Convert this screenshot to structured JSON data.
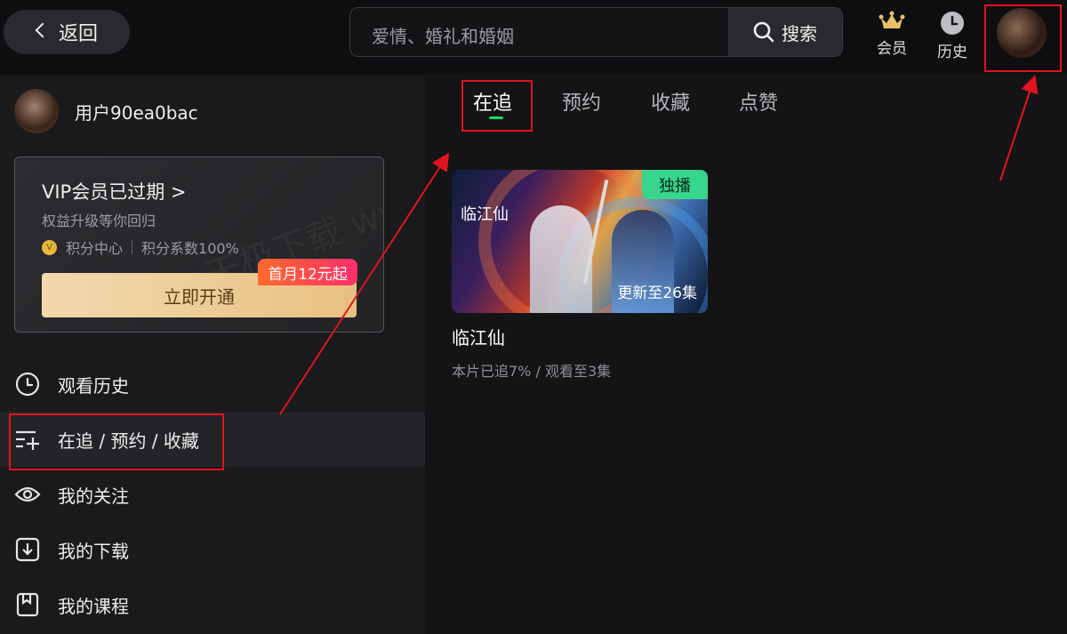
{
  "topbar": {
    "back_label": "返回",
    "search_placeholder": "爱情、婚礼和婚姻",
    "search_button": "搜索",
    "vip_label": "会员",
    "history_label": "历史"
  },
  "user": {
    "name": "用户90ea0bac"
  },
  "vip_card": {
    "title": "VIP会员已过期 >",
    "subtitle": "权益升级等你回归",
    "points_center": "积分中心",
    "points_rate": "积分系数100%",
    "promo_badge": "首月12元起",
    "open_button": "立即开通"
  },
  "menu": {
    "items": [
      {
        "label": "观看历史",
        "icon": "clock-icon"
      },
      {
        "label": "在追 / 预约 / 收藏",
        "icon": "list-add-icon"
      },
      {
        "label": "我的关注",
        "icon": "eye-icon"
      },
      {
        "label": "我的下载",
        "icon": "download-icon"
      },
      {
        "label": "我的课程",
        "icon": "bookmark-icon"
      }
    ],
    "active_index": 1
  },
  "tabs": [
    {
      "label": "在追",
      "active": true
    },
    {
      "label": "预约",
      "active": false
    },
    {
      "label": "收藏",
      "active": false
    },
    {
      "label": "点赞",
      "active": false
    }
  ],
  "card": {
    "art_title": "临江仙",
    "badge": "独播",
    "episode_overlay": "更新至26集",
    "title": "临江仙",
    "progress": "本片已追7% / 观看至3集"
  },
  "colors": {
    "accent_green": "#1ed760",
    "annotation_red": "#e0141e",
    "vip_gold": "#e8c081"
  }
}
